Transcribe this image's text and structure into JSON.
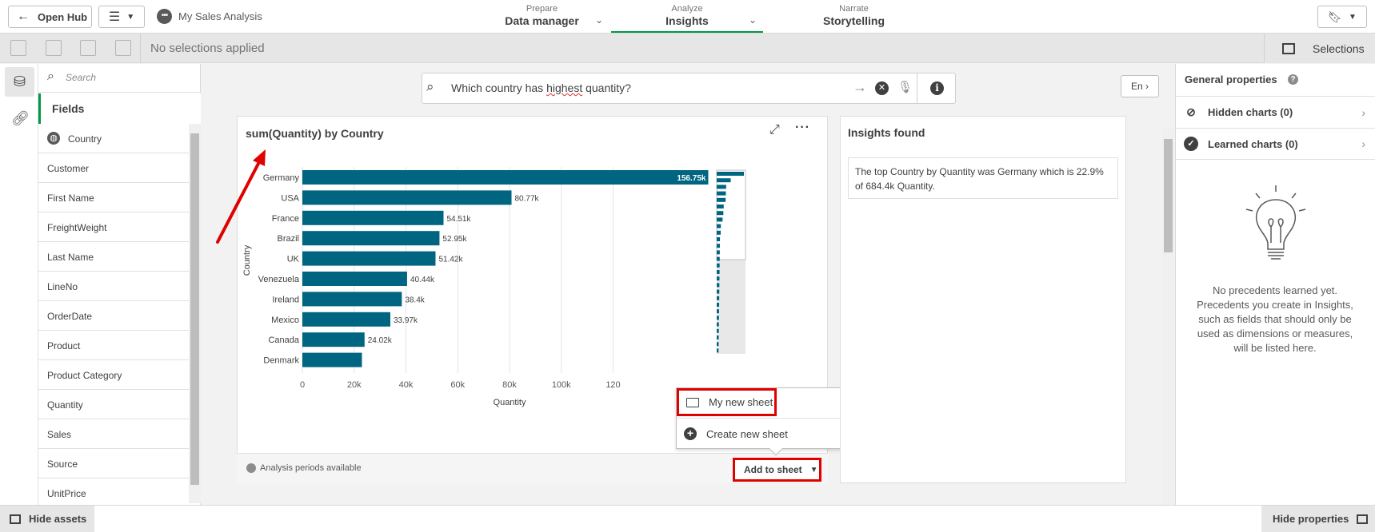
{
  "topbar": {
    "open_hub": "Open Hub",
    "app_name": "My Sales Analysis",
    "tabs": [
      {
        "sub": "Prepare",
        "main": "Data manager"
      },
      {
        "sub": "Analyze",
        "main": "Insights"
      },
      {
        "sub": "Narrate",
        "main": "Storytelling"
      }
    ]
  },
  "selection_bar": {
    "text": "No selections applied",
    "selections_label": "Selections"
  },
  "assets": {
    "search_placeholder": "Search",
    "fields_header": "Fields",
    "fields": [
      "Country",
      "Customer",
      "First Name",
      "FreightWeight",
      "Last Name",
      "LineNo",
      "OrderDate",
      "Product",
      "Product Category",
      "Quantity",
      "Sales",
      "Source",
      "UnitPrice"
    ]
  },
  "nlq": {
    "question_pre": "Which country has ",
    "question_sq": "highest",
    "question_post": " quantity?",
    "lang": "En"
  },
  "chart": {
    "title": "sum(Quantity) by Country",
    "footer_text": "Analysis periods available",
    "add_to_sheet": "Add to sheet",
    "popup": {
      "my_sheet": "My new sheet",
      "create_sheet": "Create new sheet"
    }
  },
  "chart_data": {
    "type": "bar",
    "orientation": "horizontal",
    "title": "sum(Quantity) by Country",
    "xlabel": "Quantity",
    "ylabel": "Country",
    "categories": [
      "Germany",
      "USA",
      "France",
      "Brazil",
      "UK",
      "Venezuela",
      "Ireland",
      "Mexico",
      "Canada",
      "Denmark"
    ],
    "values": [
      156750,
      80770,
      54510,
      52950,
      51420,
      40440,
      38400,
      33970,
      24020,
      23000
    ],
    "data_labels": [
      "156.75k",
      "80.77k",
      "54.51k",
      "52.95k",
      "51.42k",
      "40.44k",
      "38.4k",
      "33.97k",
      "24.02k",
      ""
    ],
    "x_ticks": [
      "0",
      "20k",
      "40k",
      "60k",
      "80k",
      "100k",
      "120"
    ],
    "xlim": [
      0,
      160000
    ],
    "color": "#006580",
    "grid": true
  },
  "insights": {
    "title": "Insights found",
    "text": "The top Country by Quantity was Germany which is 22.9% of 684.4k Quantity."
  },
  "properties": {
    "title": "General properties",
    "hidden_charts": "Hidden charts (0)",
    "learned_charts": "Learned charts (0)",
    "empty_text": "No precedents learned yet. Precedents you create in Insights, such as fields that should only be used as dimensions or measures, will be listed here."
  },
  "bottombar": {
    "hide_assets": "Hide assets",
    "hide_properties": "Hide properties"
  }
}
